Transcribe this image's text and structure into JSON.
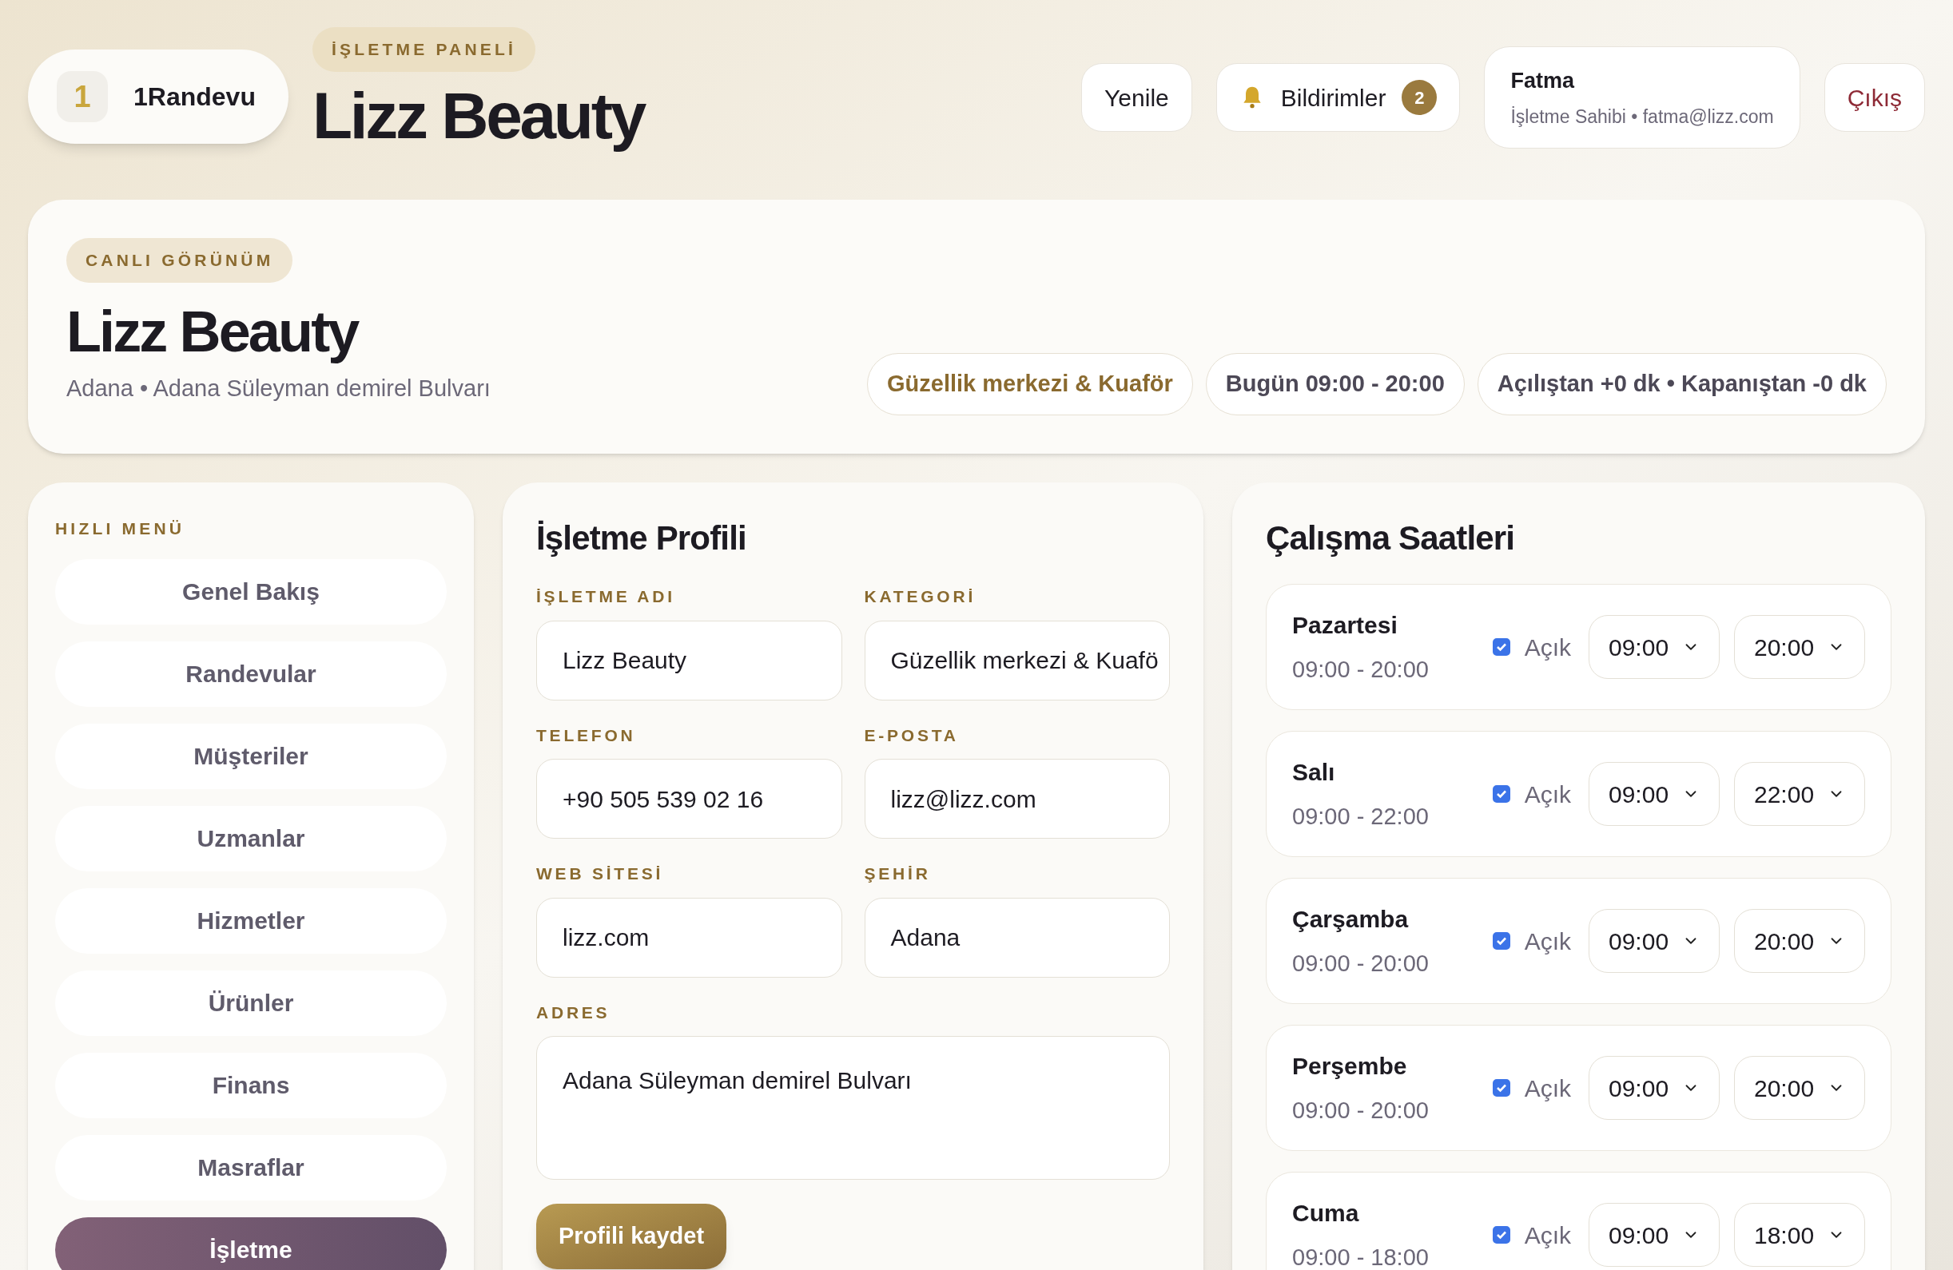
{
  "brand": {
    "badge": "1",
    "name": "1Randevu"
  },
  "header": {
    "eyebrow": "İŞLETME PANELİ",
    "title": "Lizz Beauty"
  },
  "actions": {
    "refresh": "Yenile",
    "notifications": {
      "label": "Bildirimler",
      "count": "2"
    },
    "user": {
      "name": "Fatma",
      "detail": "İşletme Sahibi • fatma@lizz.com"
    },
    "logout": "Çıkış"
  },
  "hero": {
    "eyebrow": "CANLI GÖRÜNÜM",
    "title": "Lizz Beauty",
    "location": "Adana • Adana Süleyman demirel Bulvarı",
    "chips": [
      {
        "kind": "accent",
        "text": "Güzellik merkezi & Kuaför"
      },
      {
        "kind": "plain",
        "text": "Bugün 09:00 - 20:00"
      },
      {
        "kind": "plain",
        "text": "Açılıştan +0 dk • Kapanıştan -0 dk"
      }
    ]
  },
  "menu": {
    "title": "HIZLI MENÜ",
    "items": [
      {
        "label": "Genel Bakış",
        "selected": false
      },
      {
        "label": "Randevular",
        "selected": false
      },
      {
        "label": "Müşteriler",
        "selected": false
      },
      {
        "label": "Uzmanlar",
        "selected": false
      },
      {
        "label": "Hizmetler",
        "selected": false
      },
      {
        "label": "Ürünler",
        "selected": false
      },
      {
        "label": "Finans",
        "selected": false
      },
      {
        "label": "Masraflar",
        "selected": false
      },
      {
        "label": "İşletme",
        "selected": true
      }
    ]
  },
  "profile": {
    "title": "İşletme Profili",
    "fields": [
      {
        "label": "İŞLETME ADI",
        "value": "Lizz Beauty"
      },
      {
        "label": "KATEGORİ",
        "value": "Güzellik merkezi & Kuafö"
      },
      {
        "label": "TELEFON",
        "value": "+90 505 539 02 16"
      },
      {
        "label": "E-POSTA",
        "value": "lizz@lizz.com"
      },
      {
        "label": "WEB SİTESİ",
        "value": "lizz.com"
      },
      {
        "label": "ŞEHİR",
        "value": "Adana"
      }
    ],
    "address": {
      "label": "ADRES",
      "value": "Adana Süleyman demirel Bulvarı"
    },
    "save": "Profili kaydet"
  },
  "hours": {
    "title": "Çalışma Saatleri",
    "days": [
      {
        "name": "Pazartesi",
        "summary": "09:00 - 20:00",
        "open": true,
        "open_label": "Açık",
        "start": "09:00",
        "end": "20:00"
      },
      {
        "name": "Salı",
        "summary": "09:00 - 22:00",
        "open": true,
        "open_label": "Açık",
        "start": "09:00",
        "end": "22:00"
      },
      {
        "name": "Çarşamba",
        "summary": "09:00 - 20:00",
        "open": true,
        "open_label": "Açık",
        "start": "09:00",
        "end": "20:00"
      },
      {
        "name": "Perşembe",
        "summary": "09:00 - 20:00",
        "open": true,
        "open_label": "Açık",
        "start": "09:00",
        "end": "20:00"
      },
      {
        "name": "Cuma",
        "summary": "09:00 - 18:00",
        "open": true,
        "open_label": "Açık",
        "start": "09:00",
        "end": "18:00"
      }
    ]
  }
}
